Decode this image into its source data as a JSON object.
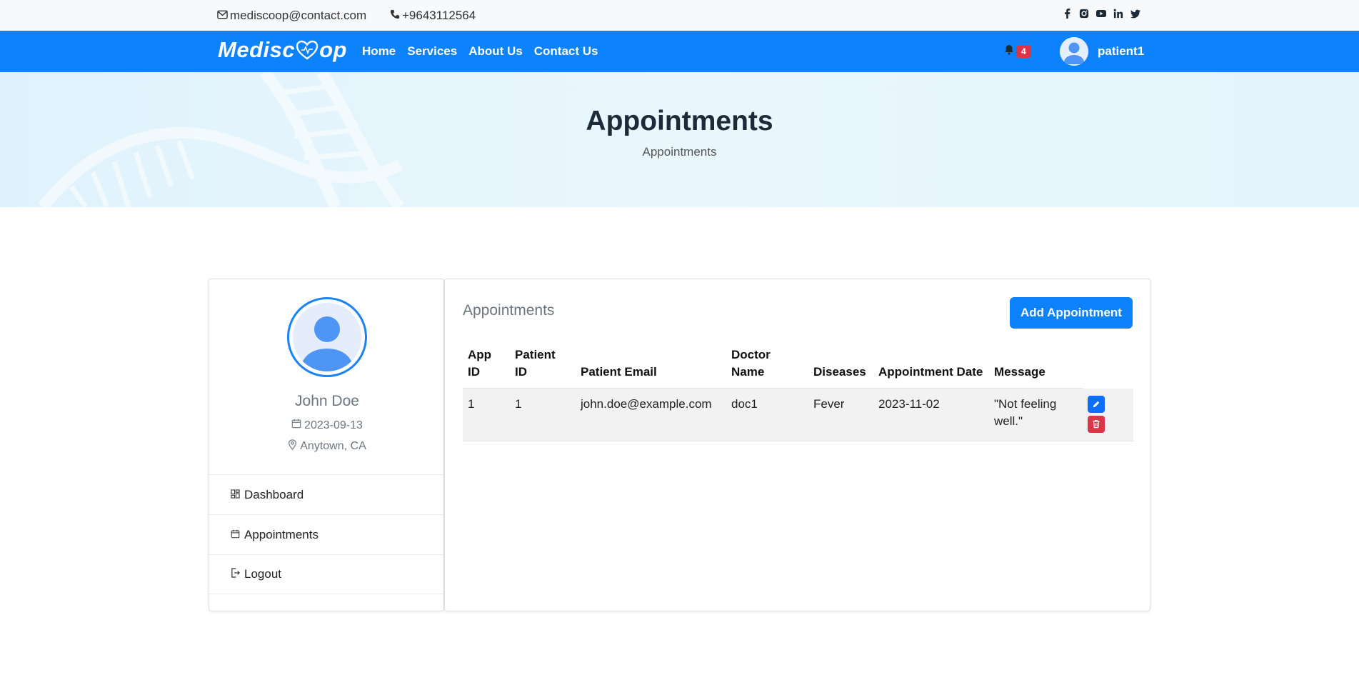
{
  "topbar": {
    "email": "mediscoop@contact.com",
    "phone": "+9643112564",
    "socials": [
      "facebook-icon",
      "instagram-icon",
      "youtube-icon",
      "linkedin-icon",
      "twitter-icon"
    ]
  },
  "navbar": {
    "brand_left": "Medisc",
    "brand_right": "op",
    "links": [
      "Home",
      "Services",
      "About Us",
      "Contact Us"
    ],
    "notification_count": "4",
    "username": "patient1",
    "color": "#0d82fd"
  },
  "hero": {
    "title": "Appointments",
    "breadcrumb": "Appointments"
  },
  "profile": {
    "name": "John Doe",
    "dob": "2023-09-13",
    "location": "Anytown, CA",
    "menu": [
      "Dashboard",
      "Appointments",
      "Logout"
    ]
  },
  "main": {
    "title": "Appointments",
    "add_button": "Add Appointment",
    "table": {
      "headers": [
        "App ID",
        "Patient ID",
        "Patient Email",
        "Doctor Name",
        "Diseases",
        "Appointment Date",
        "Message"
      ],
      "rows": [
        [
          "1",
          "1",
          "john.doe@example.com",
          "doc1",
          "Fever",
          "2023-11-02",
          "\"Not feeling well.\""
        ]
      ]
    }
  }
}
